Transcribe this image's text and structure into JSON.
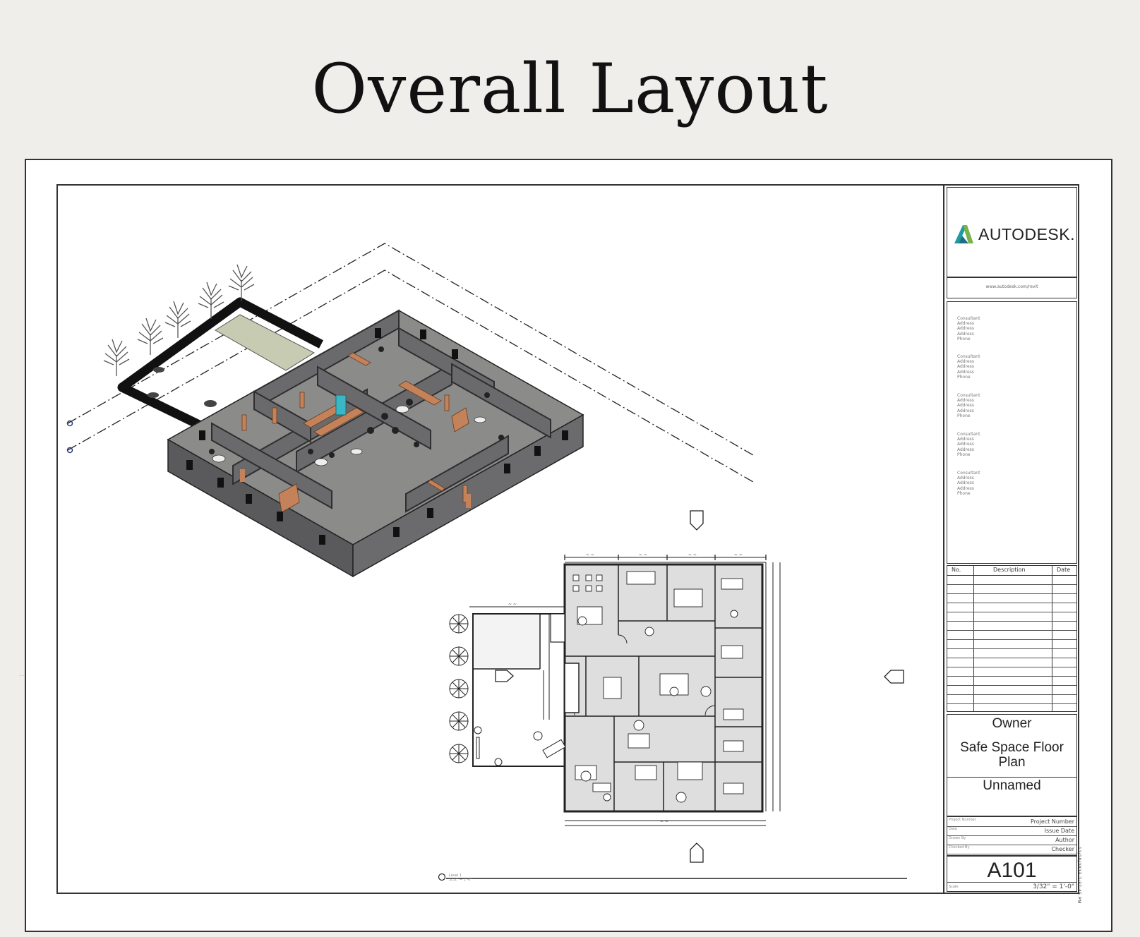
{
  "page": {
    "title": "Overall Layout"
  },
  "title_block": {
    "logo_text": "AUTODESK.",
    "url": "www.autodesk.com/revit",
    "consultants": [
      [
        "Consultant",
        "Address",
        "Address",
        "Address",
        "Phone"
      ],
      [
        "Consultant",
        "Address",
        "Address",
        "Address",
        "Phone"
      ],
      [
        "Consultant",
        "Address",
        "Address",
        "Address",
        "Phone"
      ],
      [
        "Consultant",
        "Address",
        "Address",
        "Address",
        "Phone"
      ],
      [
        "Consultant",
        "Address",
        "Address",
        "Address",
        "Phone"
      ]
    ],
    "revision_headers": {
      "no": "No.",
      "description": "Description",
      "date": "Date"
    },
    "owner": "Owner",
    "project_name": "Safe Space Floor Plan",
    "sheet_name": "Unnamed",
    "info": [
      {
        "label": "Project Number",
        "value": "Project Number"
      },
      {
        "label": "Date",
        "value": "Issue Date"
      },
      {
        "label": "Drawn By",
        "value": "Author"
      },
      {
        "label": "Checked By",
        "value": "Checker"
      }
    ],
    "sheet_number": "A101",
    "scale_label": "Scale",
    "scale": "3/32\" = 1'-0\"",
    "side_text": "11/10/2023 7:37:45 PM"
  },
  "view": {
    "label": "Level 1",
    "scale": "3/32\" = 1'-0\""
  },
  "colors": {
    "wall": "#57575a",
    "floor": "#8a8a88",
    "furniture": "#c4825a",
    "plan_fill": "#dedede",
    "line": "#222222"
  }
}
